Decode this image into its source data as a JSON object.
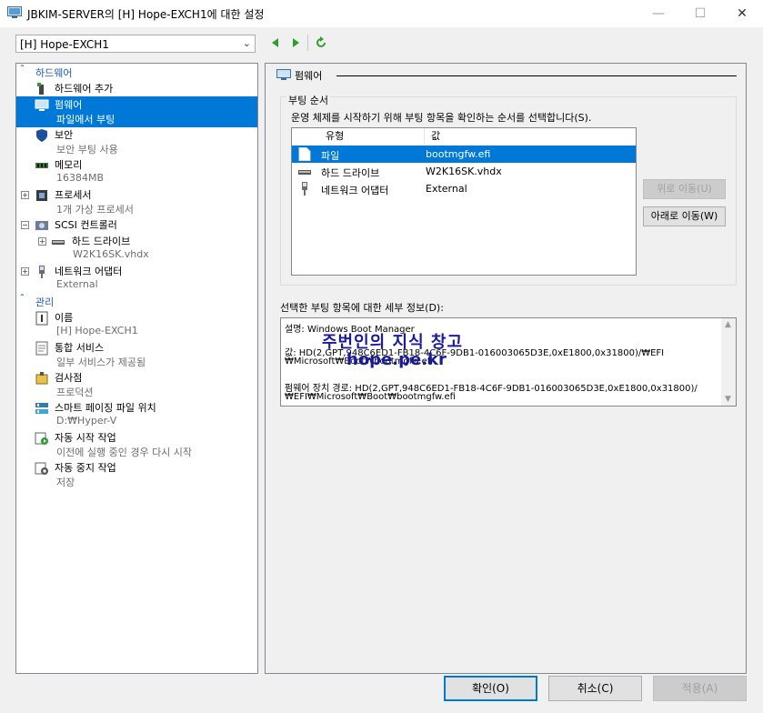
{
  "window": {
    "title": "JBKIM-SERVER의 [H] Hope-EXCH1에 대한 설정"
  },
  "vm_selector": {
    "value": "[H] Hope-EXCH1"
  },
  "sidebar": {
    "sections": [
      {
        "label": "하드웨어"
      },
      {
        "label": "관리"
      }
    ],
    "hardware_items": [
      {
        "title": "하드웨어 추가",
        "sub": "",
        "icon": "add-hardware-icon"
      },
      {
        "title": "펌웨어",
        "sub": "파일에서 부팅",
        "icon": "firmware-icon"
      },
      {
        "title": "보안",
        "sub": "보안 부팅 사용",
        "icon": "shield-icon"
      },
      {
        "title": "메모리",
        "sub": "16384MB",
        "icon": "memory-icon"
      },
      {
        "title": "프로세서",
        "sub": "1개 가상 프로세서",
        "icon": "processor-icon"
      },
      {
        "title": "SCSI 컨트롤러",
        "sub": "",
        "icon": "scsi-controller-icon"
      },
      {
        "title": "하드 드라이브",
        "sub": "W2K16SK.vhdx",
        "icon": "hard-drive-icon"
      },
      {
        "title": "네트워크 어댑터",
        "sub": "External",
        "icon": "network-adapter-icon"
      }
    ],
    "management_items": [
      {
        "title": "이름",
        "sub": "[H] Hope-EXCH1",
        "icon": "name-icon"
      },
      {
        "title": "통합 서비스",
        "sub": "일부 서비스가 제공됨",
        "icon": "integration-services-icon"
      },
      {
        "title": "검사점",
        "sub": "프로덕션",
        "icon": "checkpoint-icon"
      },
      {
        "title": "스마트 페이징 파일 위치",
        "sub": "D:₩Hyper-V",
        "icon": "smart-paging-icon"
      },
      {
        "title": "자동 시작 작업",
        "sub": "이전에 실행 중인 경우 다시 시작",
        "icon": "auto-start-icon"
      },
      {
        "title": "자동 중지 작업",
        "sub": "저장",
        "icon": "auto-stop-icon"
      }
    ]
  },
  "firmware": {
    "header": "펌웨어",
    "boot_group_label": "부팅 순서",
    "boot_description": "운영 체제를 시작하기 위해 부팅 항목을 확인하는 순서를 선택합니다(S).",
    "columns": [
      "유형",
      "값"
    ],
    "boot_entries": [
      {
        "type": "파일",
        "value": "bootmgfw.efi"
      },
      {
        "type": "하드 드라이브",
        "value": "W2K16SK.vhdx"
      },
      {
        "type": "네트워크 어댑터",
        "value": "External"
      }
    ],
    "move_up_label": "위로 이동(U)",
    "move_down_label": "아래로 이동(W)",
    "detail_label": "선택한 부팅 항목에 대한 세부 정보(D):",
    "detail_lines": [
      "설명: Windows Boot Manager",
      "",
      "값: HD(2,GPT,948C6ED1-FB18-4C6F-9DB1-016003065D3E,0xE1800,0x31800)/₩EFI",
      "₩Microsoft₩Boot₩bootmgfw.efi",
      "",
      "펌웨어 장치 경로: HD(2,GPT,948C6ED1-FB18-4C6F-9DB1-016003065D3E,0xE1800,0x31800)/",
      "₩EFI₩Microsoft₩Boot₩bootmgfw.efi"
    ],
    "watermark_line1": "주번인의 지식 창고",
    "watermark_line2": "hope.pe.kr"
  },
  "footer": {
    "ok_label": "확인(O)",
    "cancel_label": "취소(C)",
    "apply_label": "적용(A)"
  },
  "colors": {
    "selection": "#0078d7",
    "section_header": "#1f5ab0"
  }
}
